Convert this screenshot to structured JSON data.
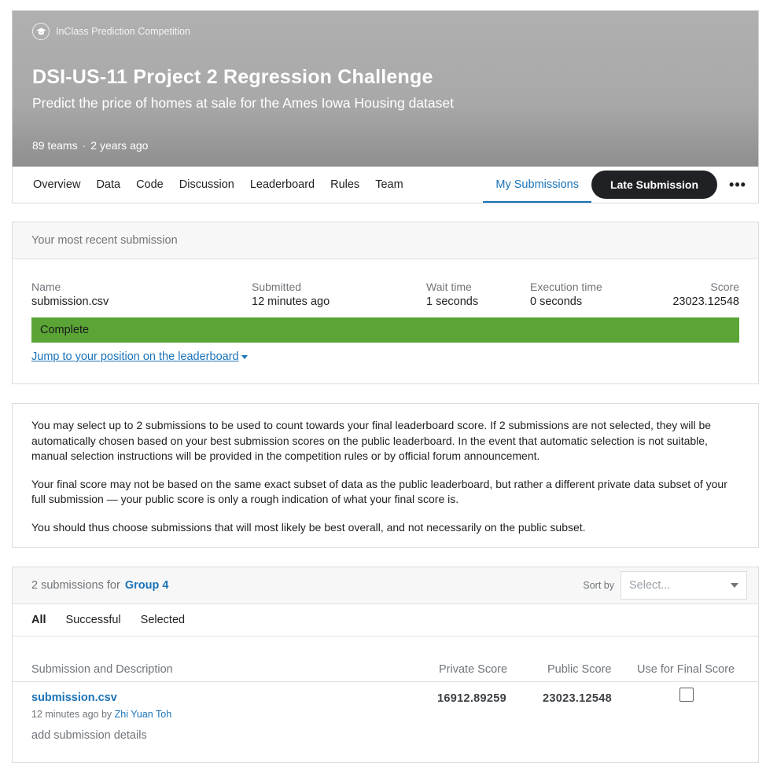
{
  "header": {
    "badge_label": "InClass Prediction Competition",
    "badge_icon": "graduation-cap-icon",
    "title": "DSI-US-11 Project 2 Regression Challenge",
    "subtitle": "Predict the price of homes at sale for the Ames Iowa Housing dataset",
    "teams": "89 teams",
    "separator": "·",
    "age": "2 years ago"
  },
  "nav": {
    "tabs": [
      "Overview",
      "Data",
      "Code",
      "Discussion",
      "Leaderboard",
      "Rules",
      "Team"
    ],
    "active_tab": "My Submissions",
    "late_submission": "Late Submission",
    "more": "•••"
  },
  "recent": {
    "header": "Your most recent submission",
    "name_label": "Name",
    "name_value": "submission.csv",
    "submitted_label": "Submitted",
    "submitted_value": "12 minutes ago",
    "wait_label": "Wait time",
    "wait_value": "1 seconds",
    "exec_label": "Execution time",
    "exec_value": "0 seconds",
    "score_label": "Score",
    "score_value": "23023.12548",
    "status": "Complete",
    "status_color": "#5aa536",
    "jump_link": "Jump to your position on the leaderboard"
  },
  "info": {
    "p1": "You may select up to 2 submissions to be used to count towards your final leaderboard score. If 2 submissions are not selected, they will be automatically chosen based on your best submission scores on the public leaderboard. In the event that automatic selection is not suitable, manual selection instructions will be provided in the competition rules or by official forum announcement.",
    "p2": "Your final score may not be based on the same exact subset of data as the public leaderboard, but rather a different private data subset of your full submission — your public score is only a rough indication of what your final score is.",
    "p3": "You should thus choose submissions that will most likely be best overall, and not necessarily on the public subset."
  },
  "submissions": {
    "count_text": "2 submissions for",
    "group": "Group 4",
    "sort_label": "Sort by",
    "sort_placeholder": "Select...",
    "filters": [
      "All",
      "Successful",
      "Selected"
    ],
    "active_filter": "All",
    "columns": {
      "desc": "Submission and Description",
      "private": "Private Score",
      "public": "Public Score",
      "final": "Use for Final Score"
    },
    "rows": [
      {
        "file": "submission.csv",
        "time": "12 minutes ago by",
        "user": "Zhi Yuan Toh",
        "add_details": "add submission details",
        "private_score": "16912.89259",
        "public_score": "23023.12548",
        "selected": false
      }
    ]
  }
}
